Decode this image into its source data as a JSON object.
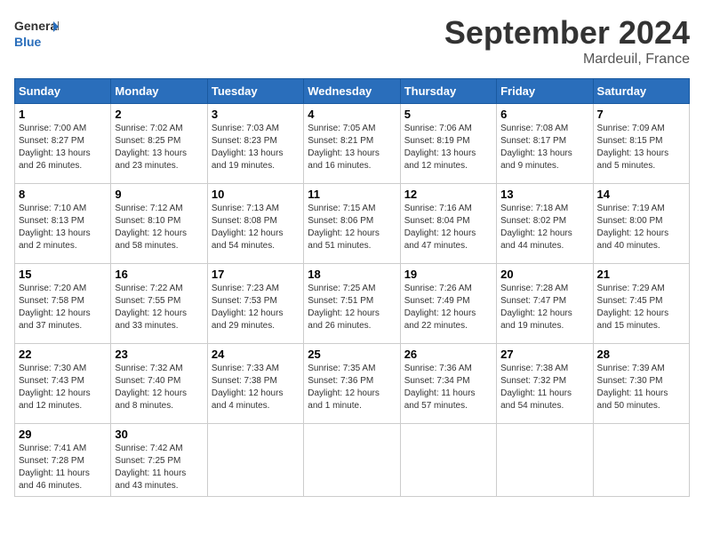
{
  "logo": {
    "line1": "General",
    "line2": "Blue"
  },
  "title": "September 2024",
  "subtitle": "Mardeuil, France",
  "days_of_week": [
    "Sunday",
    "Monday",
    "Tuesday",
    "Wednesday",
    "Thursday",
    "Friday",
    "Saturday"
  ],
  "weeks": [
    [
      {
        "day": "1",
        "info": "Sunrise: 7:00 AM\nSunset: 8:27 PM\nDaylight: 13 hours\nand 26 minutes."
      },
      {
        "day": "2",
        "info": "Sunrise: 7:02 AM\nSunset: 8:25 PM\nDaylight: 13 hours\nand 23 minutes."
      },
      {
        "day": "3",
        "info": "Sunrise: 7:03 AM\nSunset: 8:23 PM\nDaylight: 13 hours\nand 19 minutes."
      },
      {
        "day": "4",
        "info": "Sunrise: 7:05 AM\nSunset: 8:21 PM\nDaylight: 13 hours\nand 16 minutes."
      },
      {
        "day": "5",
        "info": "Sunrise: 7:06 AM\nSunset: 8:19 PM\nDaylight: 13 hours\nand 12 minutes."
      },
      {
        "day": "6",
        "info": "Sunrise: 7:08 AM\nSunset: 8:17 PM\nDaylight: 13 hours\nand 9 minutes."
      },
      {
        "day": "7",
        "info": "Sunrise: 7:09 AM\nSunset: 8:15 PM\nDaylight: 13 hours\nand 5 minutes."
      }
    ],
    [
      {
        "day": "8",
        "info": "Sunrise: 7:10 AM\nSunset: 8:13 PM\nDaylight: 13 hours\nand 2 minutes."
      },
      {
        "day": "9",
        "info": "Sunrise: 7:12 AM\nSunset: 8:10 PM\nDaylight: 12 hours\nand 58 minutes."
      },
      {
        "day": "10",
        "info": "Sunrise: 7:13 AM\nSunset: 8:08 PM\nDaylight: 12 hours\nand 54 minutes."
      },
      {
        "day": "11",
        "info": "Sunrise: 7:15 AM\nSunset: 8:06 PM\nDaylight: 12 hours\nand 51 minutes."
      },
      {
        "day": "12",
        "info": "Sunrise: 7:16 AM\nSunset: 8:04 PM\nDaylight: 12 hours\nand 47 minutes."
      },
      {
        "day": "13",
        "info": "Sunrise: 7:18 AM\nSunset: 8:02 PM\nDaylight: 12 hours\nand 44 minutes."
      },
      {
        "day": "14",
        "info": "Sunrise: 7:19 AM\nSunset: 8:00 PM\nDaylight: 12 hours\nand 40 minutes."
      }
    ],
    [
      {
        "day": "15",
        "info": "Sunrise: 7:20 AM\nSunset: 7:58 PM\nDaylight: 12 hours\nand 37 minutes."
      },
      {
        "day": "16",
        "info": "Sunrise: 7:22 AM\nSunset: 7:55 PM\nDaylight: 12 hours\nand 33 minutes."
      },
      {
        "day": "17",
        "info": "Sunrise: 7:23 AM\nSunset: 7:53 PM\nDaylight: 12 hours\nand 29 minutes."
      },
      {
        "day": "18",
        "info": "Sunrise: 7:25 AM\nSunset: 7:51 PM\nDaylight: 12 hours\nand 26 minutes."
      },
      {
        "day": "19",
        "info": "Sunrise: 7:26 AM\nSunset: 7:49 PM\nDaylight: 12 hours\nand 22 minutes."
      },
      {
        "day": "20",
        "info": "Sunrise: 7:28 AM\nSunset: 7:47 PM\nDaylight: 12 hours\nand 19 minutes."
      },
      {
        "day": "21",
        "info": "Sunrise: 7:29 AM\nSunset: 7:45 PM\nDaylight: 12 hours\nand 15 minutes."
      }
    ],
    [
      {
        "day": "22",
        "info": "Sunrise: 7:30 AM\nSunset: 7:43 PM\nDaylight: 12 hours\nand 12 minutes."
      },
      {
        "day": "23",
        "info": "Sunrise: 7:32 AM\nSunset: 7:40 PM\nDaylight: 12 hours\nand 8 minutes."
      },
      {
        "day": "24",
        "info": "Sunrise: 7:33 AM\nSunset: 7:38 PM\nDaylight: 12 hours\nand 4 minutes."
      },
      {
        "day": "25",
        "info": "Sunrise: 7:35 AM\nSunset: 7:36 PM\nDaylight: 12 hours\nand 1 minute."
      },
      {
        "day": "26",
        "info": "Sunrise: 7:36 AM\nSunset: 7:34 PM\nDaylight: 11 hours\nand 57 minutes."
      },
      {
        "day": "27",
        "info": "Sunrise: 7:38 AM\nSunset: 7:32 PM\nDaylight: 11 hours\nand 54 minutes."
      },
      {
        "day": "28",
        "info": "Sunrise: 7:39 AM\nSunset: 7:30 PM\nDaylight: 11 hours\nand 50 minutes."
      }
    ],
    [
      {
        "day": "29",
        "info": "Sunrise: 7:41 AM\nSunset: 7:28 PM\nDaylight: 11 hours\nand 46 minutes."
      },
      {
        "day": "30",
        "info": "Sunrise: 7:42 AM\nSunset: 7:25 PM\nDaylight: 11 hours\nand 43 minutes."
      },
      {
        "day": "",
        "info": ""
      },
      {
        "day": "",
        "info": ""
      },
      {
        "day": "",
        "info": ""
      },
      {
        "day": "",
        "info": ""
      },
      {
        "day": "",
        "info": ""
      }
    ]
  ]
}
